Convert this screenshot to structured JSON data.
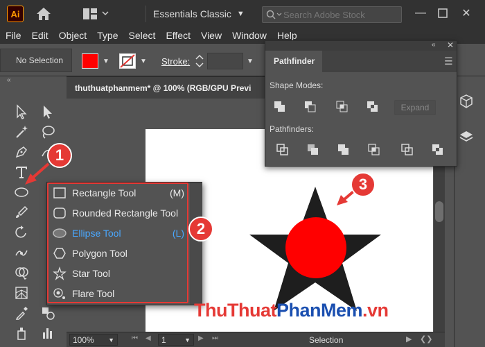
{
  "app": {
    "logo": "Ai",
    "workspace": "Essentials Classic",
    "search_placeholder": "Search Adobe Stock"
  },
  "menu": [
    "File",
    "Edit",
    "Object",
    "Type",
    "Select",
    "Effect",
    "View",
    "Window",
    "Help"
  ],
  "control_bar": {
    "selection": "No Selection",
    "fill_color": "#ff0000",
    "stroke_label": "Stroke:"
  },
  "document": {
    "tab_title": "thuthuatphanmem* @ 100% (RGB/GPU Previ",
    "zoom": "100%",
    "page": "1",
    "status": "Selection"
  },
  "pathfinder": {
    "title": "Pathfinder",
    "shape_modes_label": "Shape Modes:",
    "pathfinders_label": "Pathfinders:",
    "expand_label": "Expand"
  },
  "flyout": {
    "items": [
      {
        "label": "Rectangle Tool",
        "shortcut": "(M)",
        "icon": "rectangle-icon"
      },
      {
        "label": "Rounded Rectangle Tool",
        "shortcut": "",
        "icon": "rounded-rectangle-icon"
      },
      {
        "label": "Ellipse Tool",
        "shortcut": "(L)",
        "icon": "ellipse-icon",
        "active": true
      },
      {
        "label": "Polygon Tool",
        "shortcut": "",
        "icon": "polygon-icon"
      },
      {
        "label": "Star Tool",
        "shortcut": "",
        "icon": "star-icon"
      },
      {
        "label": "Flare Tool",
        "shortcut": "",
        "icon": "flare-icon"
      }
    ]
  },
  "annotations": [
    "1",
    "2",
    "3"
  ],
  "artwork": {
    "star_color": "#1e1e1e",
    "circle_color": "#ff0000"
  },
  "watermark": {
    "part1": "ThuThuat",
    "part2": "PhanMem",
    "part3": ".vn"
  },
  "colors": {
    "accent_red": "#e53935",
    "active_blue": "#4aa8ff",
    "ui_dark": "#323232",
    "ui_mid": "#535353"
  }
}
